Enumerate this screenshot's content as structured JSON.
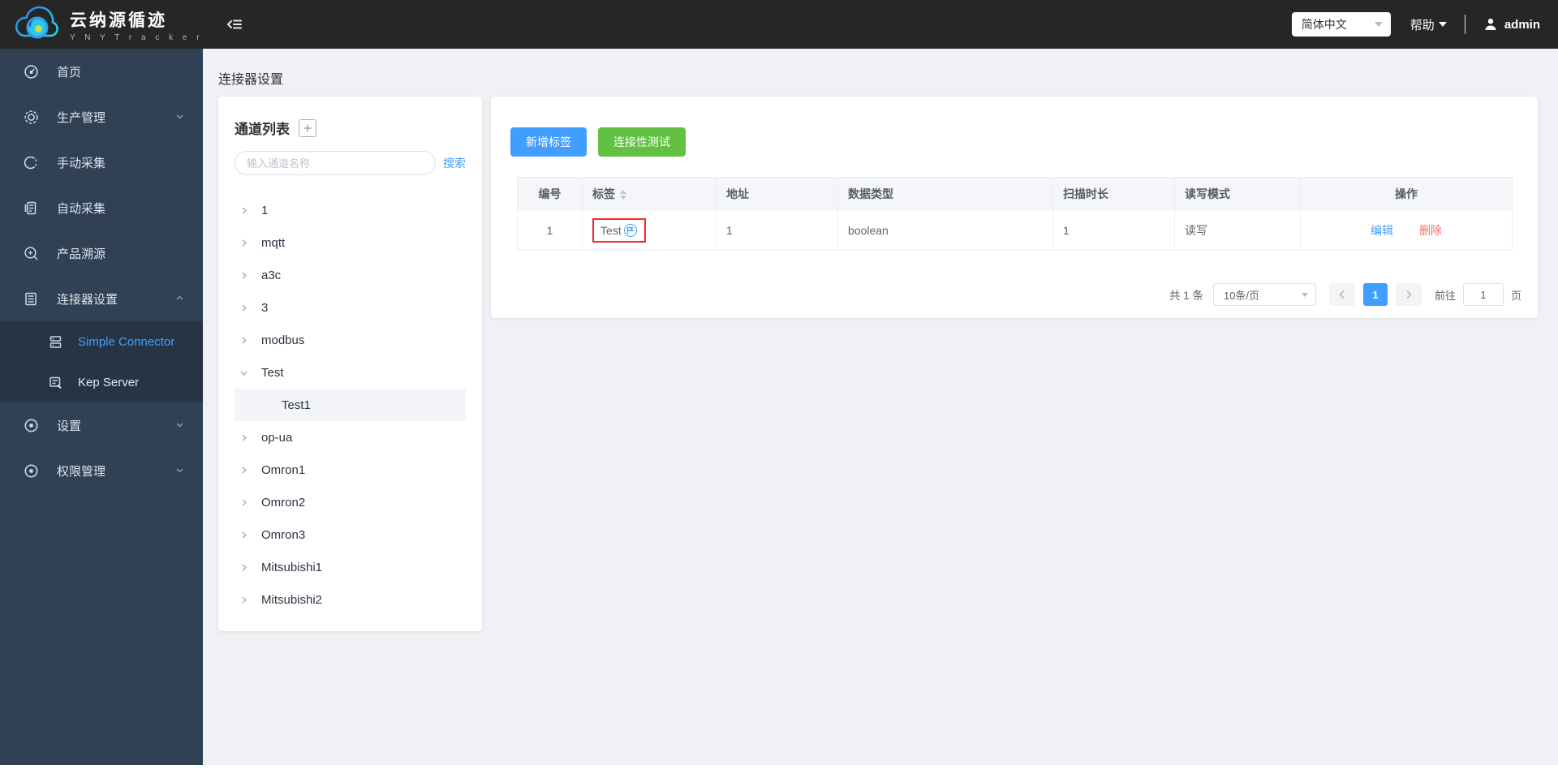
{
  "header": {
    "app_title": "云纳源循迹",
    "app_subtitle": "Y N Y T r a c k e r",
    "language": "简体中文",
    "help_label": "帮助",
    "username": "admin"
  },
  "sidebar": {
    "items": [
      {
        "label": "首页"
      },
      {
        "label": "生产管理"
      },
      {
        "label": "手动采集"
      },
      {
        "label": "自动采集"
      },
      {
        "label": "产品溯源"
      },
      {
        "label": "连接器设置"
      },
      {
        "label": "设置"
      },
      {
        "label": "权限管理"
      }
    ],
    "submenu": [
      {
        "label": "Simple Connector"
      },
      {
        "label": "Kep Server"
      }
    ]
  },
  "main": {
    "breadcrumb": "连接器设置"
  },
  "channel_panel": {
    "title": "通道列表",
    "search_placeholder": "输入通道名称",
    "search_label": "搜索",
    "items": [
      "1",
      "mqtt",
      "a3c",
      "3",
      "modbus",
      "Test",
      "Test1",
      "op-ua",
      "Omron1",
      "Omron2",
      "Omron3",
      "Mitsubishi1",
      "Mitsubishi2"
    ]
  },
  "toolbar": {
    "add_tag_label": "新增标签",
    "connectivity_test_label": "连接性测试"
  },
  "table": {
    "headers": [
      "编号",
      "标签",
      "地址",
      "数据类型",
      "扫描时长",
      "读写模式",
      "操作"
    ],
    "rows": [
      {
        "id": "1",
        "tag": "Test",
        "address": "1",
        "data_type": "boolean",
        "scan_duration": "1",
        "rw_mode": "读写",
        "edit_label": "编辑",
        "delete_label": "删除"
      }
    ]
  },
  "pagination": {
    "total_text": "共 1 条",
    "page_size": "10条/页",
    "current_page": "1",
    "goto_label": "前往",
    "goto_value": "1",
    "page_unit_label": "页"
  },
  "colors": {
    "primary": "#409eff",
    "success": "#62c042",
    "danger": "#f56c6c",
    "highlight_red": "#f12c2c",
    "sidebar_bg": "#304156",
    "header_bg": "#262626"
  }
}
